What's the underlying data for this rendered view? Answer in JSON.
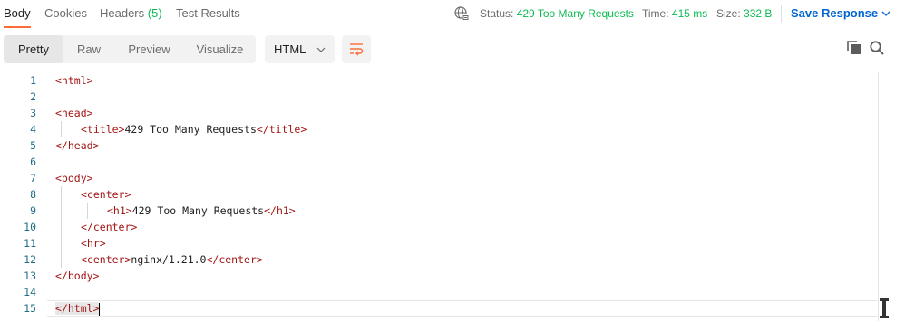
{
  "tabs": [
    {
      "label": "Body",
      "active": true
    },
    {
      "label": "Cookies"
    },
    {
      "label": "Headers",
      "count": "(5)"
    },
    {
      "label": "Test Results"
    }
  ],
  "status": {
    "status_label": "Status:",
    "status_value": "429 Too Many Requests",
    "time_label": "Time:",
    "time_value": "415 ms",
    "size_label": "Size:",
    "size_value": "332 B"
  },
  "save_response": "Save Response",
  "view_modes": [
    "Pretty",
    "Raw",
    "Preview",
    "Visualize"
  ],
  "active_view": "Pretty",
  "language": "HTML",
  "icons": {
    "globe": "network-globe-icon",
    "wrap": "wrap-lines-icon",
    "copy": "copy-icon",
    "search": "search-icon"
  },
  "colors": {
    "accent": "#ff6c37",
    "status_ok": "#0cbb52",
    "link": "#0265d2",
    "tag": "#a31515",
    "line_number": "#1f6f8b"
  },
  "code_lines": [
    {
      "n": "1",
      "indent": 0,
      "tag_open": "<html>",
      "text": "",
      "tag_close": ""
    },
    {
      "n": "2",
      "indent": 0,
      "tag_open": "",
      "text": "",
      "tag_close": ""
    },
    {
      "n": "3",
      "indent": 0,
      "tag_open": "<head>",
      "text": "",
      "tag_close": ""
    },
    {
      "n": "4",
      "indent": 1,
      "tag_open": "<title>",
      "text": "429 Too Many Requests",
      "tag_close": "</title>"
    },
    {
      "n": "5",
      "indent": 0,
      "tag_open": "</head>",
      "text": "",
      "tag_close": ""
    },
    {
      "n": "6",
      "indent": 0,
      "tag_open": "",
      "text": "",
      "tag_close": ""
    },
    {
      "n": "7",
      "indent": 0,
      "tag_open": "<body>",
      "text": "",
      "tag_close": ""
    },
    {
      "n": "8",
      "indent": 1,
      "tag_open": "<center>",
      "text": "",
      "tag_close": ""
    },
    {
      "n": "9",
      "indent": 2,
      "tag_open": "<h1>",
      "text": "429 Too Many Requests",
      "tag_close": "</h1>"
    },
    {
      "n": "10",
      "indent": 1,
      "tag_open": "</center>",
      "text": "",
      "tag_close": ""
    },
    {
      "n": "11",
      "indent": 1,
      "tag_open": "<hr>",
      "text": "",
      "tag_close": ""
    },
    {
      "n": "12",
      "indent": 1,
      "tag_open": "<center>",
      "text": "nginx/1.21.0",
      "tag_close": "</center>"
    },
    {
      "n": "13",
      "indent": 0,
      "tag_open": "</body>",
      "text": "",
      "tag_close": ""
    },
    {
      "n": "14",
      "indent": 0,
      "tag_open": "",
      "text": "",
      "tag_close": ""
    },
    {
      "n": "15",
      "indent": 0,
      "tag_open": "</html>",
      "text": "",
      "tag_close": ""
    }
  ]
}
